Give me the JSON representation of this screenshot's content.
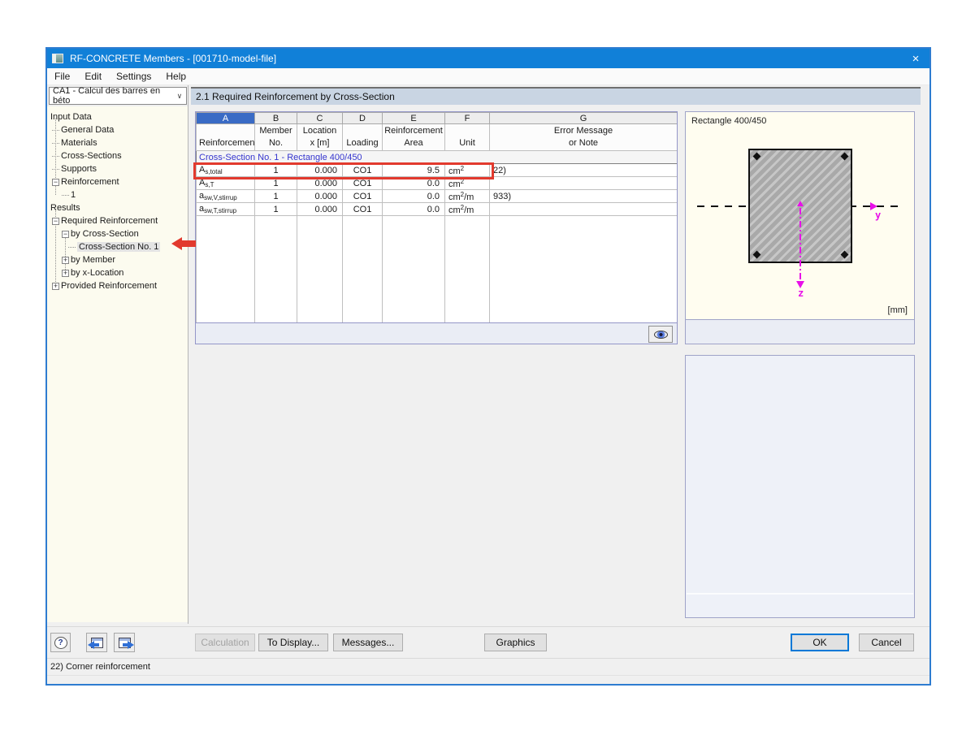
{
  "window": {
    "title": "RF-CONCRETE Members - [001710-model-file]"
  },
  "icons": {
    "close": "×",
    "chevron": "∨",
    "help": "?",
    "plus": "+",
    "minus": "−"
  },
  "menu": {
    "items": [
      "File",
      "Edit",
      "Settings",
      "Help"
    ]
  },
  "case_selector": {
    "value": "CA1 - Calcul des barres en béto"
  },
  "section_header": "2.1 Required Reinforcement by Cross-Section",
  "tree": {
    "items": [
      {
        "label": "Input Data"
      },
      {
        "label": "General Data"
      },
      {
        "label": "Materials"
      },
      {
        "label": "Cross-Sections"
      },
      {
        "label": "Supports"
      },
      {
        "label": "Reinforcement",
        "state": "expanded"
      },
      {
        "label": "1"
      },
      {
        "label": "Results"
      },
      {
        "label": "Required Reinforcement",
        "state": "expanded"
      },
      {
        "label": "by Cross-Section",
        "state": "expanded"
      },
      {
        "label": "Cross-Section No. 1",
        "selected": true
      },
      {
        "label": "by Member",
        "state": "collapsed"
      },
      {
        "label": "by x-Location",
        "state": "collapsed"
      },
      {
        "label": "Provided Reinforcement",
        "state": "collapsed"
      }
    ]
  },
  "table": {
    "col_letters": [
      "A",
      "B",
      "C",
      "D",
      "E",
      "F",
      "G"
    ],
    "headers": [
      {
        "l1": "",
        "l2": "Reinforcement"
      },
      {
        "l1": "Member",
        "l2": "No."
      },
      {
        "l1": "Location",
        "l2": "x [m]"
      },
      {
        "l1": "",
        "l2": "Loading"
      },
      {
        "l1": "Reinforcement",
        "l2": "Area"
      },
      {
        "l1": "",
        "l2": "Unit"
      },
      {
        "l1": "Error Message",
        "l2": "or Note"
      }
    ],
    "group_row": "Cross-Section No. 1 - Rectangle 400/450",
    "rows": [
      {
        "sym": "A",
        "sub": "s,total",
        "member": "1",
        "x": "0.000",
        "loading": "CO1",
        "area": "9.5",
        "unit_base": "cm",
        "unit_sup": "2",
        "unit_suffix": "",
        "note": "22)"
      },
      {
        "sym": "A",
        "sub": "s,T",
        "member": "1",
        "x": "0.000",
        "loading": "CO1",
        "area": "0.0",
        "unit_base": "cm",
        "unit_sup": "2",
        "unit_suffix": "",
        "note": ""
      },
      {
        "sym": "a",
        "sub": "sw,V,stirrup",
        "member": "1",
        "x": "0.000",
        "loading": "CO1",
        "area": "0.0",
        "unit_base": "cm",
        "unit_sup": "2",
        "unit_suffix": "/m",
        "note": "933)"
      },
      {
        "sym": "a",
        "sub": "sw,T,stirrup",
        "member": "1",
        "x": "0.000",
        "loading": "CO1",
        "area": "0.0",
        "unit_base": "cm",
        "unit_sup": "2",
        "unit_suffix": "/m",
        "note": ""
      }
    ]
  },
  "graphics": {
    "title": "Rectangle 400/450",
    "unit_label": "[mm]",
    "axis_y": "y",
    "axis_z": "z",
    "accent_color": "#E810E8",
    "section_fill": "#A9A9A9"
  },
  "buttons": {
    "calculation": "Calculation",
    "to_display": "To Display...",
    "messages": "Messages...",
    "graphics": "Graphics",
    "ok": "OK",
    "cancel": "Cancel"
  },
  "status_bar": "22) Corner reinforcement",
  "annotation_colors": {
    "highlight_red": "#E23A2E"
  }
}
